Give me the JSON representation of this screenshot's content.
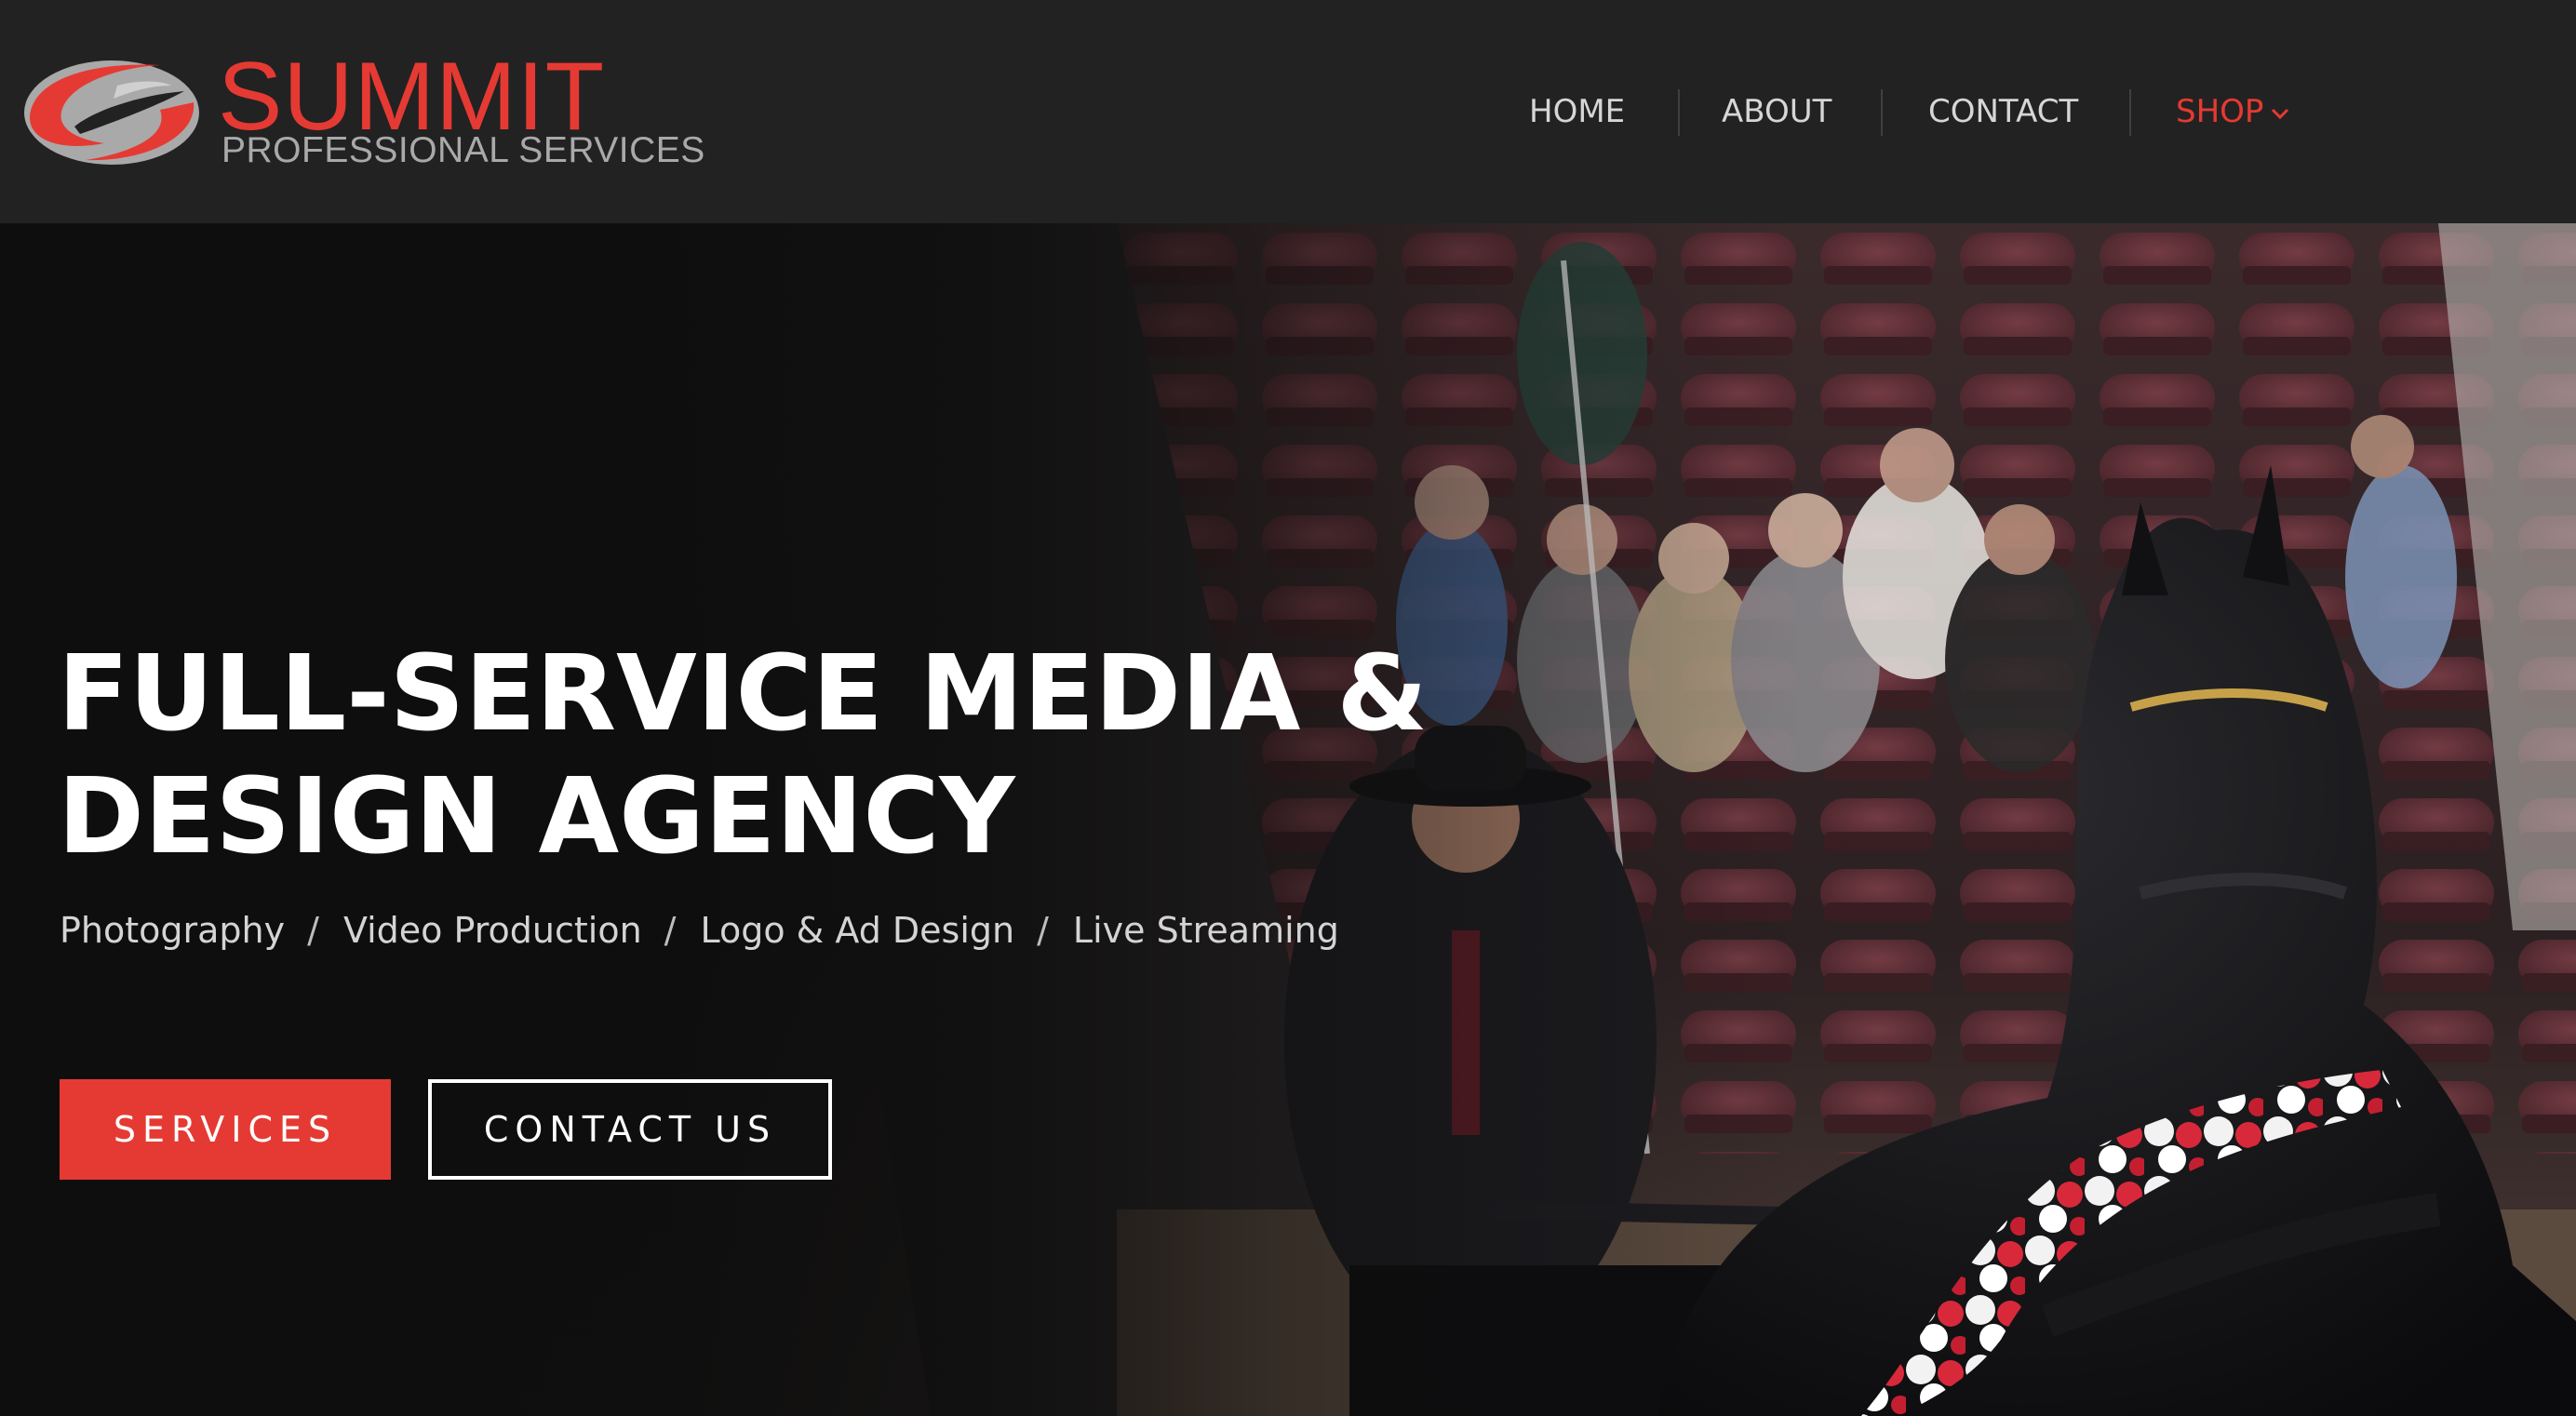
{
  "brand": {
    "name": "SUMMIT",
    "tagline": "PROFESSIONAL SERVICES",
    "primary_color": "#e53a33",
    "secondary_color": "#a9a9a9",
    "logo_icon": "swoosh-s-logo-icon"
  },
  "nav": {
    "items": [
      {
        "label": "HOME"
      },
      {
        "label": "ABOUT"
      },
      {
        "label": "CONTACT"
      },
      {
        "label": "SHOP",
        "active": true,
        "has_dropdown": true,
        "icon": "chevron-down-icon"
      }
    ]
  },
  "hero": {
    "title_line1": "FULL-SERVICE MEDIA &",
    "title_line2": "DESIGN AGENCY",
    "services": [
      "Photography",
      "Video Production",
      "Logo & Ad Design",
      "Live Streaming"
    ],
    "separator": "/",
    "buttons": {
      "primary": "SERVICES",
      "secondary": "CONTACT US"
    },
    "background_image": "horse-show-carriage-driver-photo"
  }
}
